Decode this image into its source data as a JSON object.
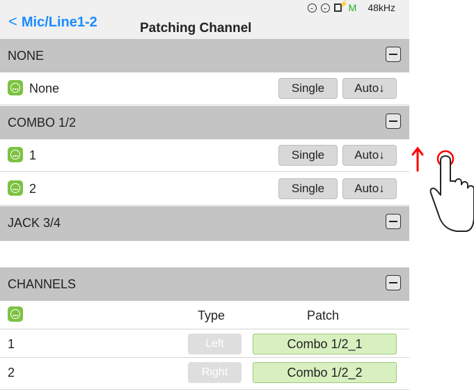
{
  "header": {
    "back_label": "Mic/Line1-2",
    "back_icon": "chevron-left-icon",
    "title": "Patching Channel",
    "status": {
      "m_label": "M",
      "sample_rate": "48kHz"
    }
  },
  "patch_sections": [
    {
      "label": "NONE",
      "rows": [
        {
          "name": "None",
          "single": "Single",
          "auto": "Auto↓"
        }
      ]
    },
    {
      "label": "COMBO 1/2",
      "rows": [
        {
          "name": "1",
          "single": "Single",
          "auto": "Auto↓"
        },
        {
          "name": "2",
          "single": "Single",
          "auto": "Auto↓"
        }
      ]
    },
    {
      "label": "JACK 3/4",
      "rows": []
    }
  ],
  "channels": {
    "label": "CHANNELS",
    "col_type": "Type",
    "col_patch": "Patch",
    "rows": [
      {
        "num": "1",
        "type": "Left",
        "patch": "Combo 1/2_1"
      },
      {
        "num": "2",
        "type": "Right",
        "patch": "Combo 1/2_2"
      }
    ]
  },
  "colors": {
    "accent": "#1a8cff",
    "xlr_green": "#7cc242",
    "section_gray": "#c4c4c4",
    "patch_green": "#d8f0c0",
    "arrow_red": "#ff0000"
  }
}
